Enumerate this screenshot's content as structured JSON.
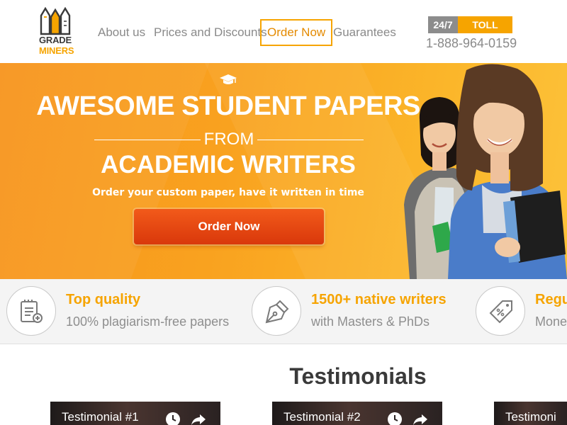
{
  "header": {
    "logo": {
      "line1": "GRADE",
      "line2": "MINERS"
    },
    "nav": [
      {
        "label": "About us"
      },
      {
        "label": "Prices and Discounts"
      },
      {
        "label": "Order Now"
      },
      {
        "label": "Guarantees"
      }
    ],
    "phone": {
      "badge_left": "24/7",
      "badge_right": "TOLL FREE",
      "number": "1-888-964-0159"
    }
  },
  "hero": {
    "title_line1": "AWESOME STUDENT PAPERS",
    "title_from": "FROM",
    "title_line2": "ACADEMIC WRITERS",
    "subtitle": "Order your custom paper, have it written in time",
    "button_label": "Order Now"
  },
  "features": [
    {
      "icon": "document-check-icon",
      "title": "Top quality",
      "desc": "100% plagiarism-free papers"
    },
    {
      "icon": "pen-nib-icon",
      "title": "1500+ native writers",
      "desc": "with Masters & PhDs"
    },
    {
      "icon": "price-tag-icon",
      "title": "Regul",
      "desc": "Money"
    }
  ],
  "testimonials": {
    "title": "Testimonials",
    "videos": [
      {
        "label": "Testimonial #1"
      },
      {
        "label": "Testimonial #2"
      },
      {
        "label": "Testimoni"
      }
    ]
  },
  "colors": {
    "accent": "#f6a400",
    "hero_start": "#f7941d",
    "hero_end": "#fcc23a",
    "cta": "#e54a12",
    "nav_text": "#8a8a8a"
  }
}
